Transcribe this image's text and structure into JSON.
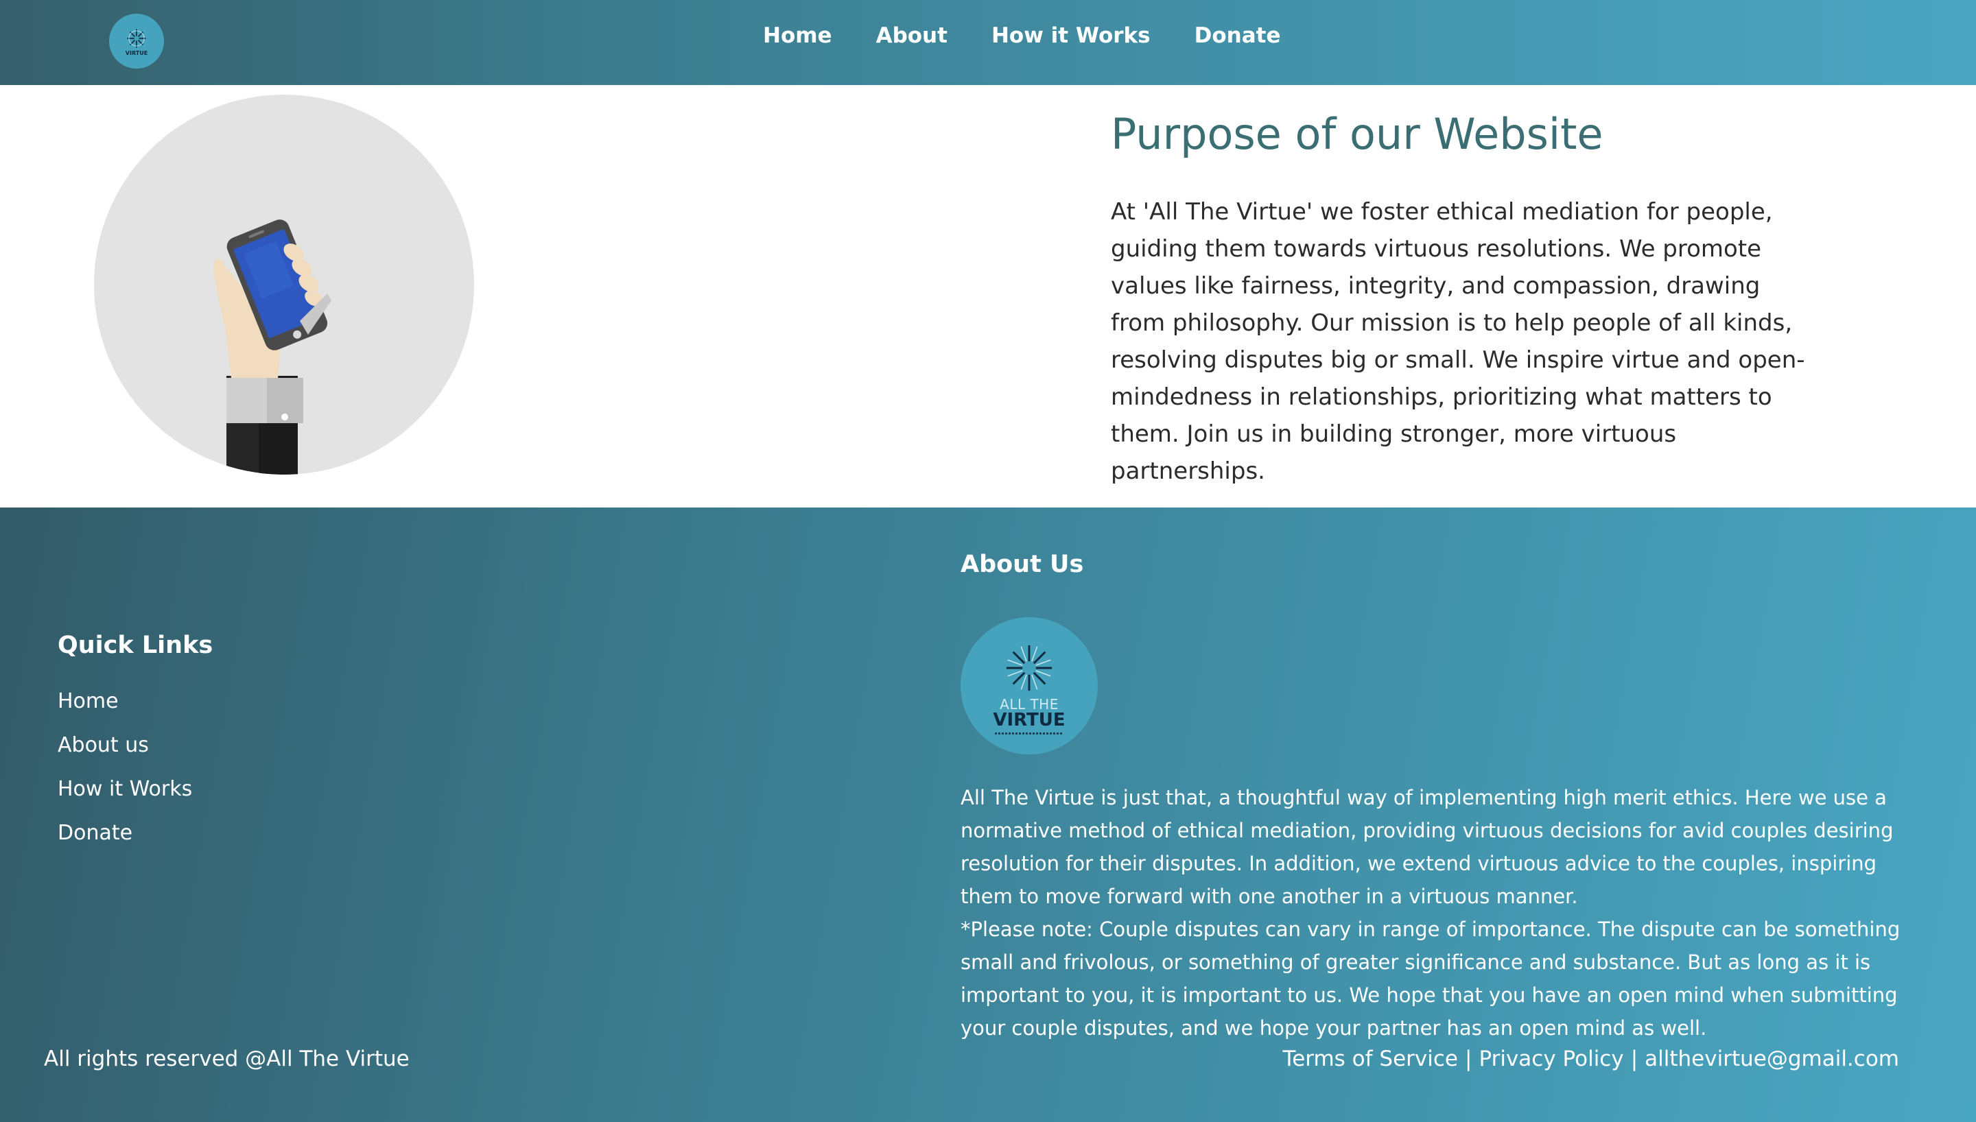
{
  "nav": {
    "logo": {
      "icon": "all-the-virtue-logo-icon",
      "text": "VIRTUE"
    },
    "links": [
      "Home",
      "About",
      "How it Works",
      "Donate"
    ]
  },
  "hero": {
    "image": {
      "icon": "hand-holding-phone-icon"
    },
    "title": "Purpose of our Website",
    "body": "At 'All The Virtue' we foster ethical mediation for people, guiding them towards virtuous resolutions. We promote values like fairness, integrity, and compassion, drawing from philosophy. Our mission is to help people of all kinds, resolving disputes big or small. We inspire virtue and open-mindedness in relationships, prioritizing what matters to them. Join us in building stronger, more virtuous partnerships."
  },
  "footer": {
    "quick_links": {
      "heading": "Quick Links",
      "items": [
        "Home",
        "About us",
        "How it Works",
        "Donate"
      ]
    },
    "about": {
      "heading": "About Us",
      "logo": {
        "icon": "all-the-virtue-logo-icon",
        "line1": "ALL THE",
        "line2": "VIRTUE"
      },
      "paragraph1": "All The Virtue is just that, a thoughtful way of implementing high merit ethics. Here we use a normative method of ethical mediation, providing virtuous decisions for avid couples desiring resolution for their disputes. In addition, we extend virtuous advice to the couples, inspiring them to move forward with one another in a virtuous manner.",
      "paragraph2": "*Please note: Couple disputes can vary in range of importance. The dispute can be something small and frivolous, or something of greater significance and substance. But as long as it is important to you, it is important to us. We hope that you have an open mind when submitting your couple disputes, and we hope your partner has an open mind as well."
    },
    "copyright": "All rights reserved @All The Virtue",
    "bottom_links": {
      "terms": "Terms of Service",
      "privacy": "Privacy Policy",
      "email": "allthevirtue@gmail.com",
      "separator": "|"
    }
  },
  "colors": {
    "gradient_dark": "#335b68",
    "gradient_light": "#4aa7c3",
    "title_teal": "#3a6e72",
    "logo_circle": "#46a3bd"
  }
}
